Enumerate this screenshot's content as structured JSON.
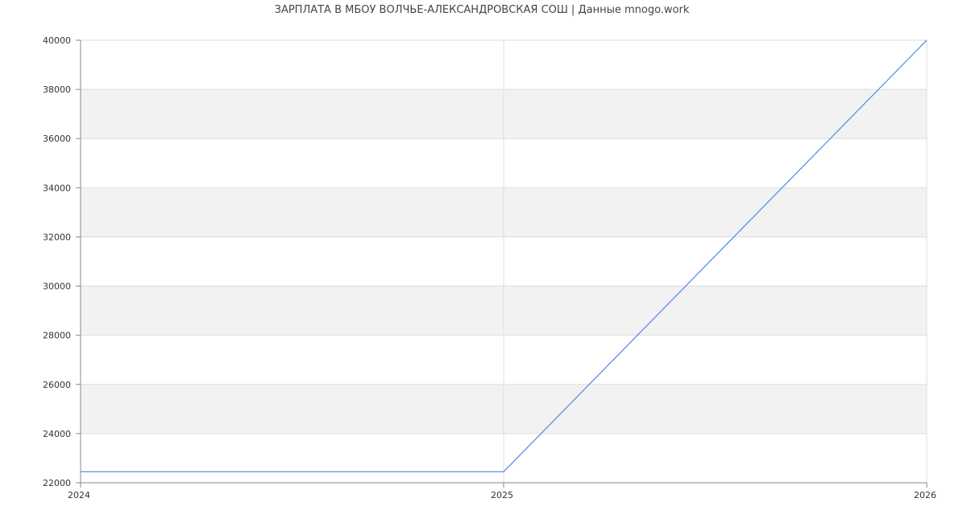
{
  "chart_data": {
    "type": "line",
    "title": "ЗАРПЛАТА В МБОУ ВОЛЧЬЕ-АЛЕКСАНДРОВСКАЯ СОШ | Данные mnogo.work",
    "xlabel": "",
    "ylabel": "",
    "x": [
      2024,
      2025,
      2026
    ],
    "x_tick_labels": [
      "2024",
      "2025",
      "2026"
    ],
    "series": [
      {
        "values": [
          22450,
          22450,
          40000
        ]
      }
    ],
    "ylim": [
      22000,
      40000
    ],
    "y_ticks": [
      22000,
      24000,
      26000,
      28000,
      30000,
      32000,
      34000,
      36000,
      38000,
      40000
    ],
    "y_tick_labels": [
      "22000",
      "24000",
      "26000",
      "28000",
      "30000",
      "32000",
      "34000",
      "36000",
      "38000",
      "40000"
    ],
    "grid": true,
    "band_color": "#f2f2f2",
    "grid_color": "#dddddd",
    "axis_color": "#888888",
    "line_color": "#5b8fe6"
  }
}
